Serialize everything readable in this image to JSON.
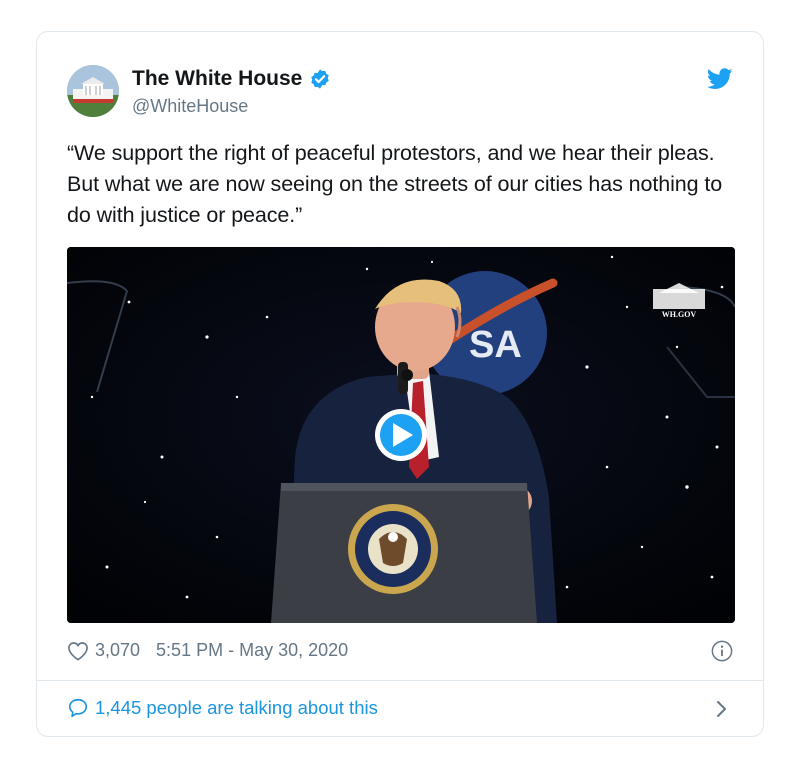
{
  "tweet": {
    "author_name": "The White House",
    "handle": "@WhiteHouse",
    "text": "“We support the right of peaceful protestors, and we hear their pleas. But what we are now seeing on the streets of our cities has nothing to do with justice or peace.”",
    "likes": "3,070",
    "timestamp": "5:51 PM - May 30, 2020",
    "conversation": "1,445 people are talking about this"
  },
  "media": {
    "watermark": "WH.GOV",
    "backdrop_text": "SA"
  },
  "colors": {
    "twitter_blue": "#1da1f2",
    "link_blue": "#1b95e0",
    "muted_gray": "#657786",
    "border": "#e1e8ed"
  },
  "icons": [
    "verified-badge-icon",
    "twitter-bird-icon",
    "play-icon",
    "heart-icon",
    "info-icon",
    "speech-bubble-icon",
    "chevron-right-icon"
  ]
}
